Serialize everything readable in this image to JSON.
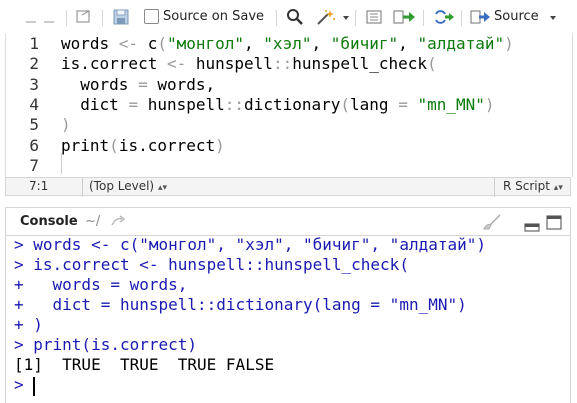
{
  "toolbar": {
    "source_on_save_label": "Source on Save",
    "source_on_save_checked": false,
    "source_label": "Source"
  },
  "editor": {
    "line_numbers": [
      "1",
      "2",
      "3",
      "4",
      "5",
      "6",
      "7"
    ],
    "lines": [
      [
        {
          "t": "words ",
          "c": ""
        },
        {
          "t": "<-",
          "c": "op"
        },
        {
          "t": " c",
          "c": ""
        },
        {
          "t": "(",
          "c": "op"
        },
        {
          "t": "\"монгол\"",
          "c": "str"
        },
        {
          "t": ", ",
          "c": ""
        },
        {
          "t": "\"хэл\"",
          "c": "str"
        },
        {
          "t": ", ",
          "c": ""
        },
        {
          "t": "\"бичиг\"",
          "c": "str"
        },
        {
          "t": ", ",
          "c": ""
        },
        {
          "t": "\"алдатай\"",
          "c": "str"
        },
        {
          "t": ")",
          "c": "op"
        }
      ],
      [
        {
          "t": "is.correct ",
          "c": ""
        },
        {
          "t": "<-",
          "c": "op"
        },
        {
          "t": " hunspell",
          "c": ""
        },
        {
          "t": "::",
          "c": "op"
        },
        {
          "t": "hunspell_check",
          "c": ""
        },
        {
          "t": "(",
          "c": "op"
        }
      ],
      [
        {
          "t": "  words ",
          "c": ""
        },
        {
          "t": "=",
          "c": "op"
        },
        {
          "t": " words,",
          "c": ""
        }
      ],
      [
        {
          "t": "  dict ",
          "c": ""
        },
        {
          "t": "=",
          "c": "op"
        },
        {
          "t": " hunspell",
          "c": ""
        },
        {
          "t": "::",
          "c": "op"
        },
        {
          "t": "dictionary",
          "c": ""
        },
        {
          "t": "(",
          "c": "op"
        },
        {
          "t": "lang ",
          "c": ""
        },
        {
          "t": "=",
          "c": "op"
        },
        {
          "t": " ",
          "c": ""
        },
        {
          "t": "\"mn_MN\"",
          "c": "str"
        },
        {
          "t": ")",
          "c": "op"
        }
      ],
      [
        {
          "t": ")",
          "c": "op"
        }
      ],
      [
        {
          "t": "print",
          "c": ""
        },
        {
          "t": "(",
          "c": "op"
        },
        {
          "t": "is.correct",
          "c": ""
        },
        {
          "t": ")",
          "c": "op"
        }
      ],
      []
    ]
  },
  "status": {
    "cursor_position": "7:1",
    "scope": "(Top Level)",
    "file_type": "R Script"
  },
  "console": {
    "title": "Console",
    "working_dir": "~/",
    "lines": [
      {
        "text": "> words <- c(\"монгол\", \"хэл\", \"бичиг\", \"алдатай\")",
        "kind": "in"
      },
      {
        "text": "> is.correct <- hunspell::hunspell_check(",
        "kind": "in"
      },
      {
        "text": "+   words = words,",
        "kind": "in"
      },
      {
        "text": "+   dict = hunspell::dictionary(lang = \"mn_MN\")",
        "kind": "in"
      },
      {
        "text": "+ )",
        "kind": "in"
      },
      {
        "text": "> print(is.correct)",
        "kind": "in"
      },
      {
        "text": "[1]  TRUE  TRUE  TRUE FALSE",
        "kind": "out"
      },
      {
        "text": ">",
        "kind": "in"
      }
    ]
  },
  "icons": [
    "back-icon",
    "forward-icon",
    "show-in-window-icon",
    "save-icon",
    "search-icon",
    "code-tools-icon",
    "outline-icon",
    "run-icon",
    "rerun-icon",
    "source-icon",
    "clear-console-icon",
    "minimize-icon",
    "maximize-icon",
    "console-goto-dir-icon"
  ]
}
